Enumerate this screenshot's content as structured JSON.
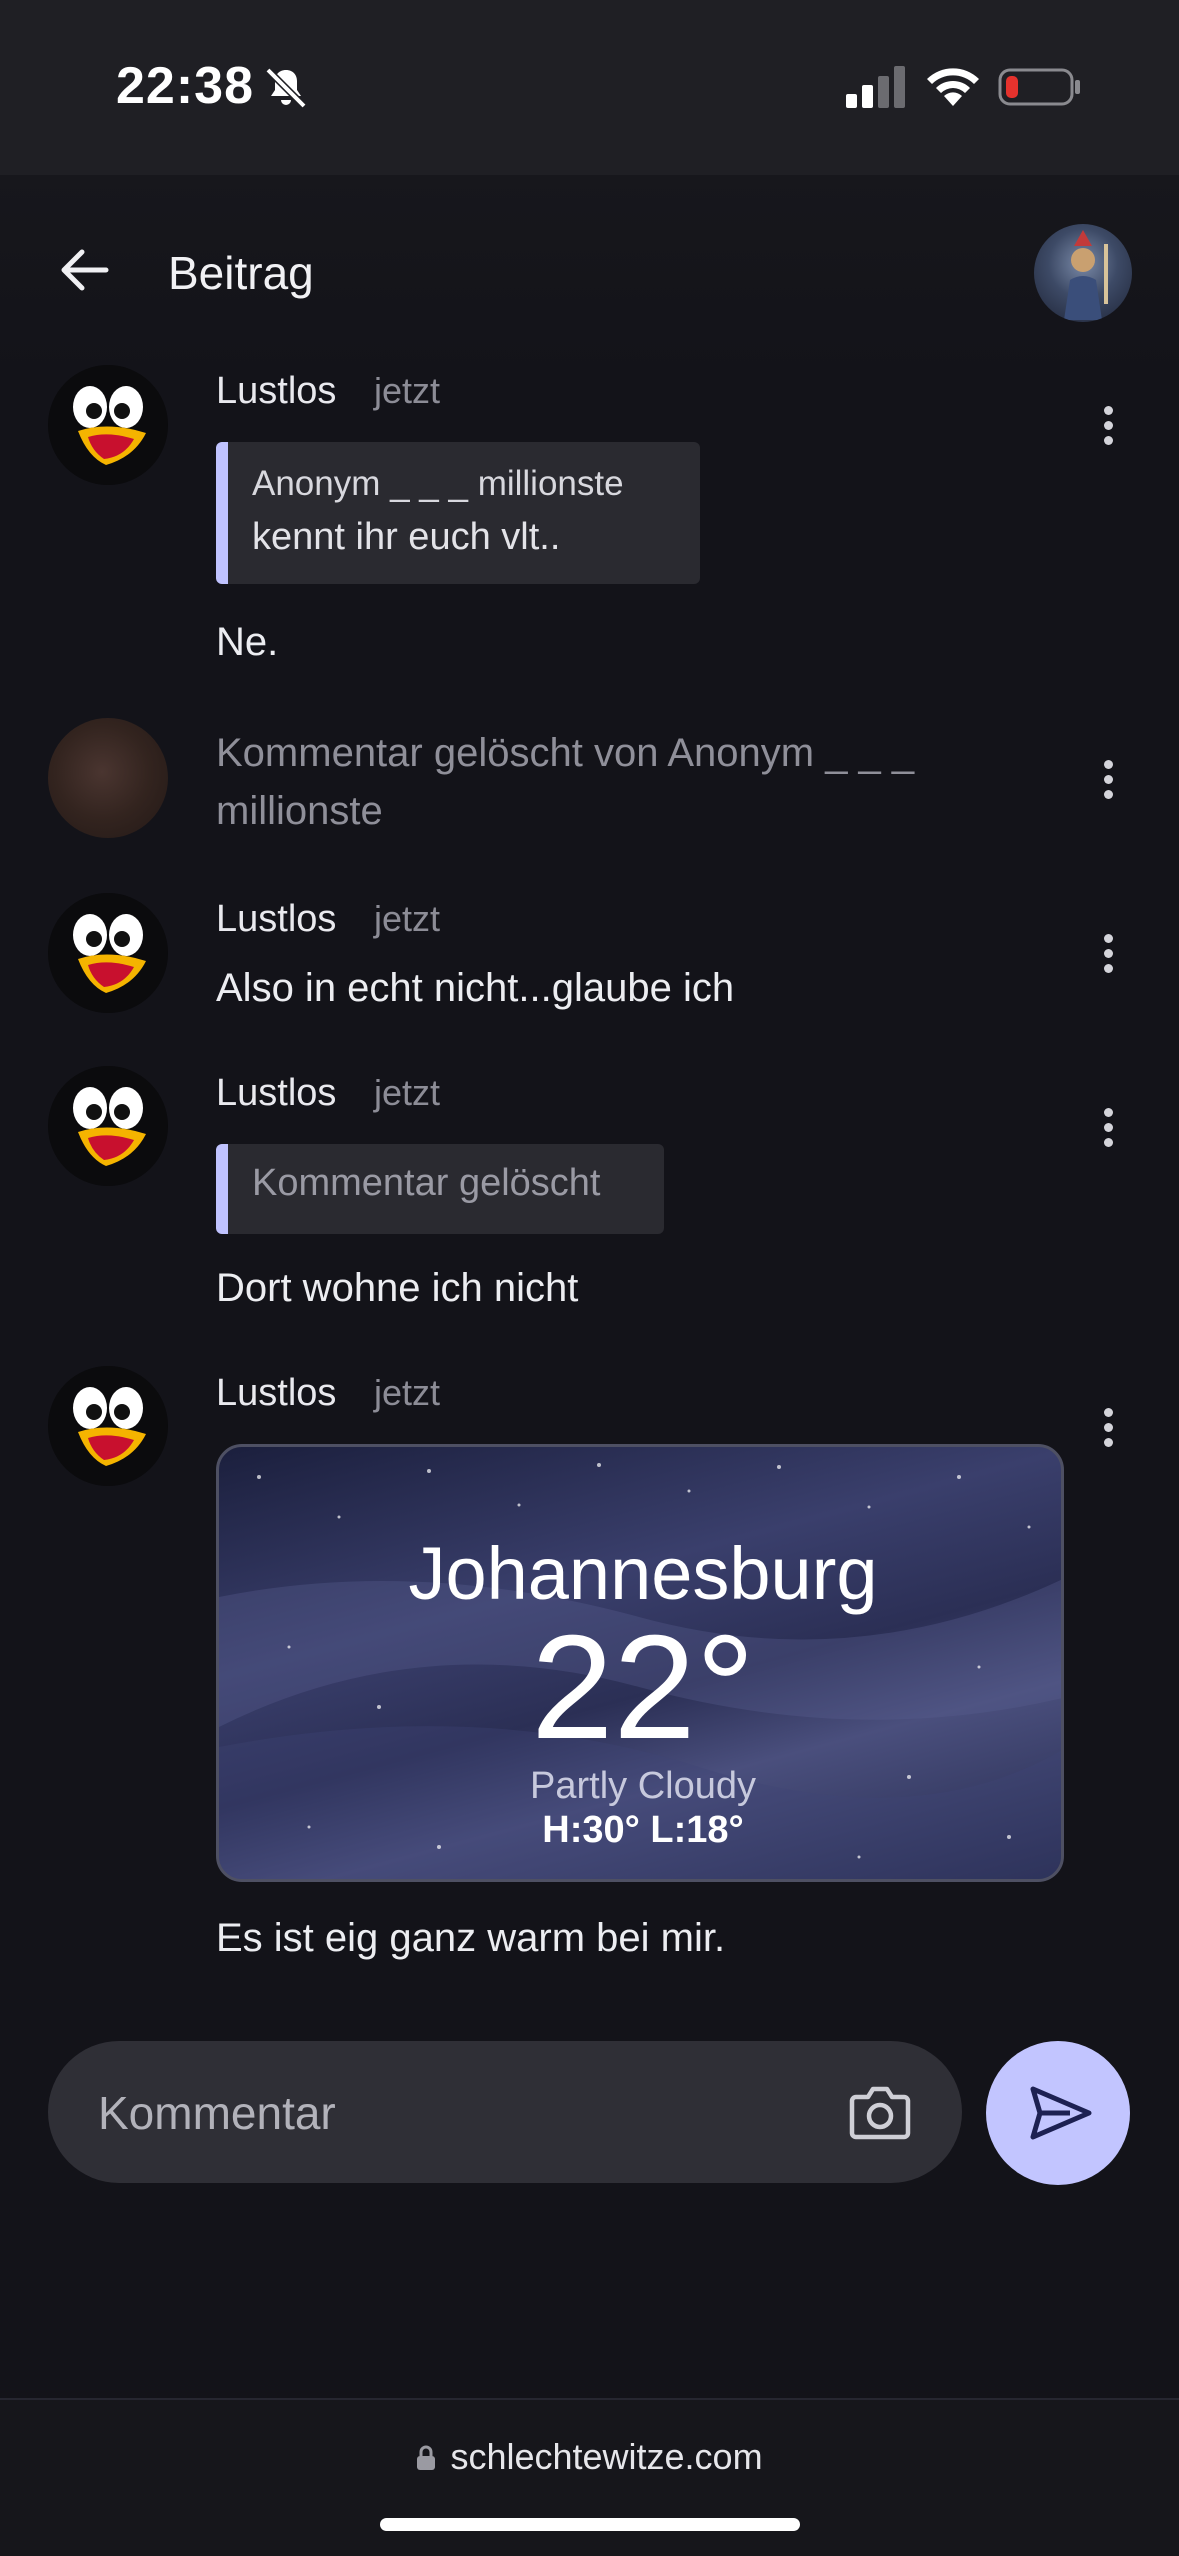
{
  "status_bar": {
    "time": "22:38",
    "icons": [
      "bell-slash-icon",
      "cellular-signal-icon",
      "wifi-icon",
      "battery-low-icon"
    ],
    "battery_color": "#e5322d"
  },
  "header": {
    "title": "Beitrag",
    "back_icon": "arrow-left-icon"
  },
  "comments": [
    {
      "author": "Lustlos",
      "time": "jetzt",
      "quote": {
        "author": "Anonym _ _ _ millionste",
        "text": "kennt ihr euch vlt.."
      },
      "text": "Ne."
    },
    {
      "deleted_text": "Kommentar gelöscht von Anonym _ _ _ millionste"
    },
    {
      "author": "Lustlos",
      "time": "jetzt",
      "text": "Also in echt nicht...glaube ich"
    },
    {
      "author": "Lustlos",
      "time": "jetzt",
      "quote_deleted": "Kommentar gelöscht",
      "text": "Dort wohne ich nicht"
    },
    {
      "author": "Lustlos",
      "time": "jetzt",
      "weather": {
        "city": "Johannesburg",
        "temp": "22°",
        "condition": "Partly Cloudy",
        "high_low": "H:30°  L:18°"
      },
      "text": "Es ist eig ganz warm bei mir."
    }
  ],
  "composer": {
    "placeholder": "Kommentar",
    "camera_icon": "camera-icon",
    "send_icon": "send-icon"
  },
  "browser": {
    "url": "schlechtewitze.com"
  },
  "colors": {
    "background": "#131319",
    "accent": "#c2c5ff",
    "quote_bar": "#c0c3ff"
  }
}
